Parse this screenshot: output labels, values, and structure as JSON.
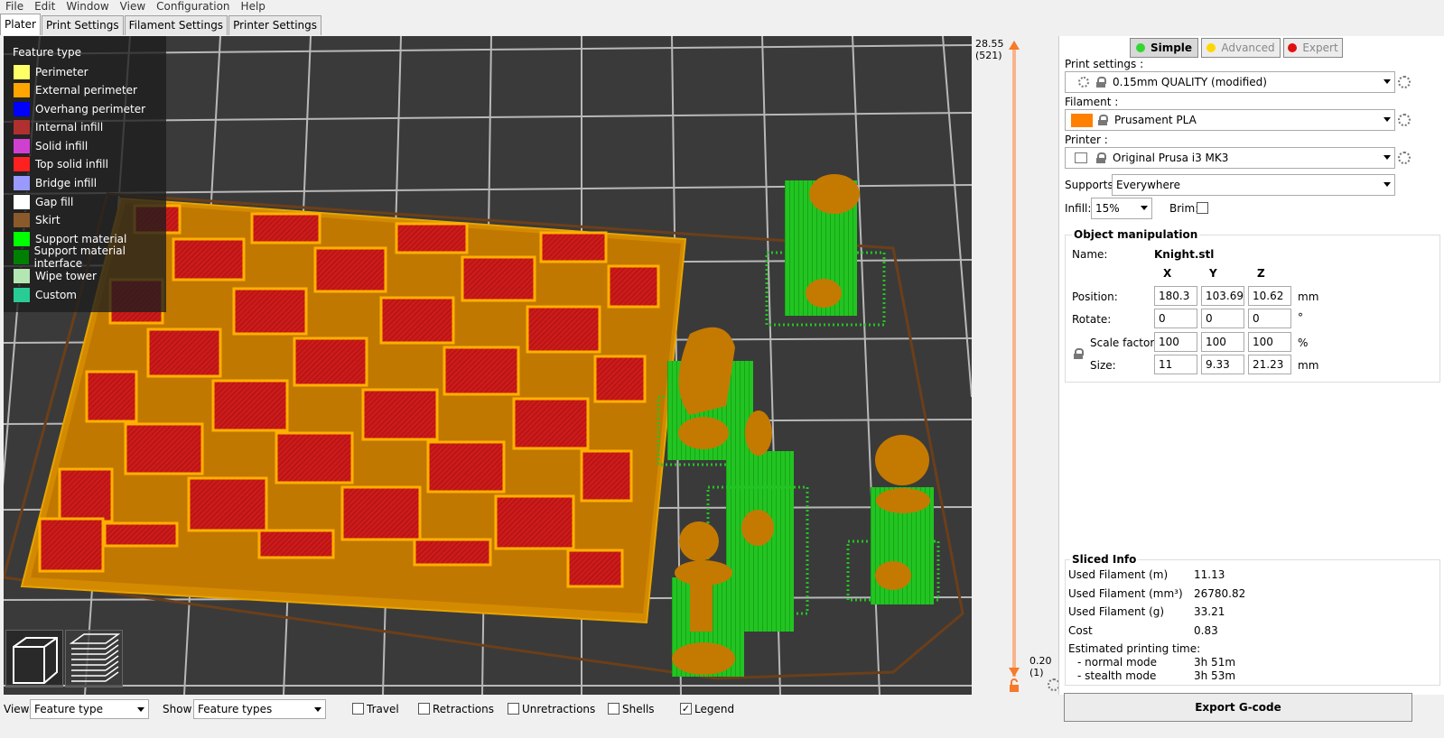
{
  "menu": [
    "File",
    "Edit",
    "Window",
    "View",
    "Configuration",
    "Help"
  ],
  "tabs": [
    "Plater",
    "Print Settings",
    "Filament Settings",
    "Printer Settings"
  ],
  "legend": {
    "title": "Feature type",
    "items": [
      {
        "label": "Perimeter",
        "color": "#ffff66"
      },
      {
        "label": "External perimeter",
        "color": "#ffa500"
      },
      {
        "label": "Overhang perimeter",
        "color": "#0000ff"
      },
      {
        "label": "Internal infill",
        "color": "#b03030"
      },
      {
        "label": "Solid infill",
        "color": "#d040d0"
      },
      {
        "label": "Top solid infill",
        "color": "#ff2020"
      },
      {
        "label": "Bridge infill",
        "color": "#9999ff"
      },
      {
        "label": "Gap fill",
        "color": "#ffffff"
      },
      {
        "label": "Skirt",
        "color": "#8b5a2b"
      },
      {
        "label": "Support material",
        "color": "#00ff00"
      },
      {
        "label": "Support material interface",
        "color": "#008000"
      },
      {
        "label": "Wipe tower",
        "color": "#b3e6b3"
      },
      {
        "label": "Custom",
        "color": "#28cc94"
      }
    ]
  },
  "layers": {
    "top_height": "28.55",
    "top_index": "(521)",
    "bottom_height": "0.20",
    "bottom_index": "(1)"
  },
  "modes": {
    "simple": "Simple",
    "advanced": "Advanced",
    "expert": "Expert"
  },
  "settings": {
    "print_label": "Print settings :",
    "print_value": "0.15mm QUALITY (modified)",
    "filament_label": "Filament :",
    "filament_value": "Prusament PLA",
    "filament_color": "#ff8000",
    "printer_label": "Printer :",
    "printer_value": "Original Prusa i3 MK3",
    "supports_label": "Supports:",
    "supports_value": "Everywhere",
    "infill_label": "Infill:",
    "infill_value": "15%",
    "brim_label": "Brim:"
  },
  "object": {
    "title": "Object manipulation",
    "name_label": "Name:",
    "name": "Knight.stl",
    "cols": [
      "X",
      "Y",
      "Z"
    ],
    "position_label": "Position:",
    "position": [
      "180.3",
      "103.69",
      "10.62"
    ],
    "position_unit": "mm",
    "rotate_label": "Rotate:",
    "rotate": [
      "0",
      "0",
      "0"
    ],
    "rotate_unit": "°",
    "scale_label": "Scale factors:",
    "scale": [
      "100",
      "100",
      "100"
    ],
    "scale_unit": "%",
    "size_label": "Size:",
    "size": [
      "11",
      "9.33",
      "21.23"
    ],
    "size_unit": "mm"
  },
  "sliced": {
    "title": "Sliced Info",
    "rows": [
      {
        "label": "Used Filament (m)",
        "value": "11.13"
      },
      {
        "label": "Used Filament (mm³)",
        "value": "26780.82"
      },
      {
        "label": "Used Filament (g)",
        "value": "33.21"
      },
      {
        "label": "Cost",
        "value": "0.83"
      }
    ],
    "time_label": "Estimated printing time:",
    "normal_label": "- normal mode",
    "normal_value": "3h 51m",
    "stealth_label": "- stealth mode",
    "stealth_value": "3h 53m"
  },
  "export_label": "Export G-code",
  "bottom": {
    "view_label": "View",
    "view_value": "Feature type",
    "show_label": "Show",
    "show_value": "Feature types",
    "travel": "Travel",
    "retractions": "Retractions",
    "unretractions": "Unretractions",
    "shells": "Shells",
    "legend": "Legend",
    "legend_checked": "✓"
  }
}
